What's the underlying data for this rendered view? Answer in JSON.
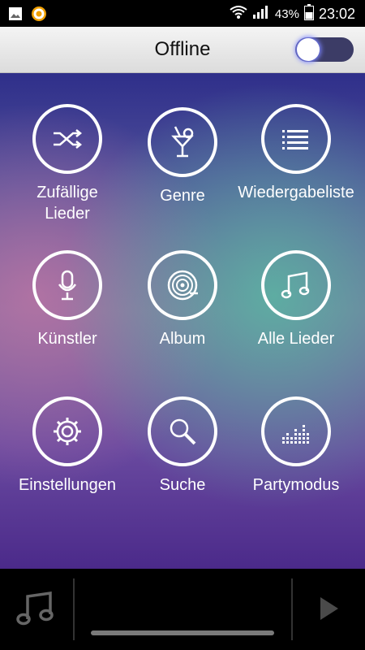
{
  "status_bar": {
    "battery": "43%",
    "time": "23:02"
  },
  "header": {
    "title": "Offline",
    "offline_toggle_on": false
  },
  "menu": {
    "items": [
      {
        "label": "Zufällige\nLieder",
        "icon": "shuffle-icon"
      },
      {
        "label": "Genre",
        "icon": "cocktail-icon"
      },
      {
        "label": "Wiedergabeliste",
        "icon": "playlist-icon"
      },
      {
        "label": "Künstler",
        "icon": "microphone-icon"
      },
      {
        "label": "Album",
        "icon": "record-icon"
      },
      {
        "label": "Alle Lieder",
        "icon": "music-note-icon"
      },
      {
        "label": "Einstellungen",
        "icon": "gear-icon"
      },
      {
        "label": "Suche",
        "icon": "magnifier-icon"
      },
      {
        "label": "Partymodus",
        "icon": "equalizer-icon"
      }
    ]
  },
  "bottom_bar": {
    "note_icon": "music-note-icon",
    "play_icon": "play-icon"
  },
  "colors": {
    "status_bar_bg": "#000000",
    "header_bg": "#e6e6e6",
    "toggle_track": "#3c3c66",
    "toggle_glow": "#7d86ff",
    "bottom_bar_bg": "#000000"
  }
}
